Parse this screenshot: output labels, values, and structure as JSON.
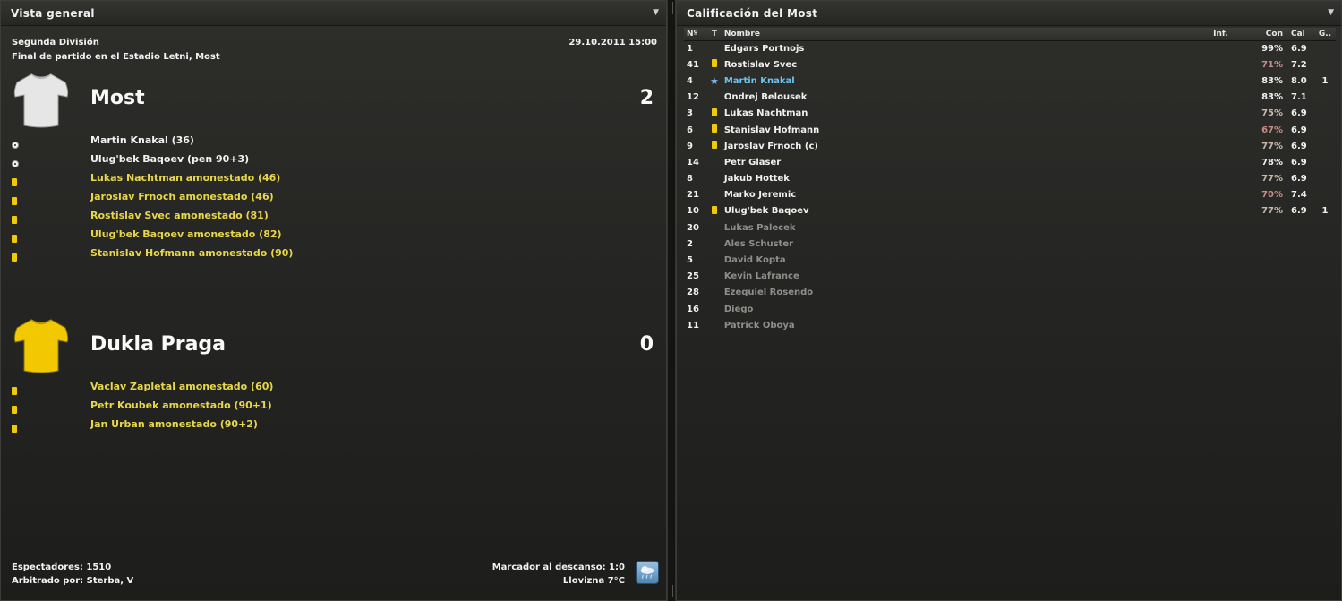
{
  "overview": {
    "title": "Vista general",
    "league": "Segunda División",
    "venue": "Final de partido en el Estadio Letni, Most",
    "datetime": "29.10.2011 15:00",
    "home": {
      "name": "Most",
      "score": "2",
      "shirt_color": "#e6e6e6",
      "events": [
        {
          "type": "goal",
          "text": "Martin Knakal (36)"
        },
        {
          "type": "goal",
          "text": "Ulug'bek Baqoev (pen 90+3)"
        },
        {
          "type": "yellow",
          "text": "Lukas Nachtman amonestado (46)"
        },
        {
          "type": "yellow",
          "text": "Jaroslav Frnoch amonestado (46)"
        },
        {
          "type": "yellow",
          "text": "Rostislav Svec amonestado (81)"
        },
        {
          "type": "yellow",
          "text": "Ulug'bek Baqoev amonestado (82)"
        },
        {
          "type": "yellow",
          "text": "Stanislav Hofmann amonestado (90)"
        }
      ]
    },
    "away": {
      "name": "Dukla Praga",
      "score": "0",
      "shirt_color": "#f2c800",
      "events": [
        {
          "type": "yellow",
          "text": "Vaclav Zapletal amonestado (60)"
        },
        {
          "type": "yellow",
          "text": "Petr Koubek amonestado (90+1)"
        },
        {
          "type": "yellow",
          "text": "Jan Urban amonestado (90+2)"
        }
      ]
    },
    "footer": {
      "spectators": "Espectadores: 1510",
      "referee": "Arbitrado por: Sterba, V",
      "halftime": "Marcador al descanso: 1:0",
      "weather": "Llovizna 7°C",
      "weather_icon": "rain-cloud-icon"
    }
  },
  "ratings": {
    "title": "Calificación del Most",
    "columns": {
      "no": "Nº",
      "t": "T",
      "name": "Nombre",
      "inf": "Inf.",
      "con": "Con",
      "cal": "Cal",
      "g": "G.."
    },
    "rows": [
      {
        "no": "1",
        "t": "",
        "name": "Edgars Portnojs",
        "inf": "",
        "con": "99%",
        "cal": "6.9",
        "g": "",
        "sub": false
      },
      {
        "no": "41",
        "t": "yellow",
        "name": "Rostislav Svec",
        "inf": "",
        "con": "71%",
        "cal": "7.2",
        "g": "",
        "sub": false
      },
      {
        "no": "4",
        "t": "star",
        "name": "Martin Knakal",
        "inf": "",
        "con": "83%",
        "cal": "8.0",
        "g": "1",
        "sub": false
      },
      {
        "no": "12",
        "t": "",
        "name": "Ondrej Belousek",
        "inf": "",
        "con": "83%",
        "cal": "7.1",
        "g": "",
        "sub": false
      },
      {
        "no": "3",
        "t": "yellow",
        "name": "Lukas Nachtman",
        "inf": "",
        "con": "75%",
        "cal": "6.9",
        "g": "",
        "sub": false
      },
      {
        "no": "6",
        "t": "yellow",
        "name": "Stanislav Hofmann",
        "inf": "",
        "con": "67%",
        "cal": "6.9",
        "g": "",
        "sub": false
      },
      {
        "no": "9",
        "t": "yellow",
        "name": "Jaroslav Frnoch (c)",
        "inf": "",
        "con": "77%",
        "cal": "6.9",
        "g": "",
        "sub": false
      },
      {
        "no": "14",
        "t": "",
        "name": "Petr Glaser",
        "inf": "",
        "con": "78%",
        "cal": "6.9",
        "g": "",
        "sub": false
      },
      {
        "no": "8",
        "t": "",
        "name": "Jakub Hottek",
        "inf": "",
        "con": "77%",
        "cal": "6.9",
        "g": "",
        "sub": false
      },
      {
        "no": "21",
        "t": "",
        "name": "Marko Jeremic",
        "inf": "",
        "con": "70%",
        "cal": "7.4",
        "g": "",
        "sub": false
      },
      {
        "no": "10",
        "t": "yellow",
        "name": "Ulug'bek Baqoev",
        "inf": "",
        "con": "77%",
        "cal": "6.9",
        "g": "1",
        "sub": false
      },
      {
        "no": "20",
        "t": "",
        "name": "Lukas Palecek",
        "inf": "",
        "con": "",
        "cal": "",
        "g": "",
        "sub": true
      },
      {
        "no": "2",
        "t": "",
        "name": "Ales Schuster",
        "inf": "",
        "con": "",
        "cal": "",
        "g": "",
        "sub": true
      },
      {
        "no": "5",
        "t": "",
        "name": "David Kopta",
        "inf": "",
        "con": "",
        "cal": "",
        "g": "",
        "sub": true
      },
      {
        "no": "25",
        "t": "",
        "name": "Kevin Lafrance",
        "inf": "",
        "con": "",
        "cal": "",
        "g": "",
        "sub": true
      },
      {
        "no": "28",
        "t": "",
        "name": "Ezequiel Rosendo",
        "inf": "",
        "con": "",
        "cal": "",
        "g": "",
        "sub": true
      },
      {
        "no": "16",
        "t": "",
        "name": "Diego",
        "inf": "",
        "con": "",
        "cal": "",
        "g": "",
        "sub": true
      },
      {
        "no": "11",
        "t": "",
        "name": "Patrick Oboya",
        "inf": "",
        "con": "",
        "cal": "",
        "g": "",
        "sub": true
      }
    ]
  }
}
